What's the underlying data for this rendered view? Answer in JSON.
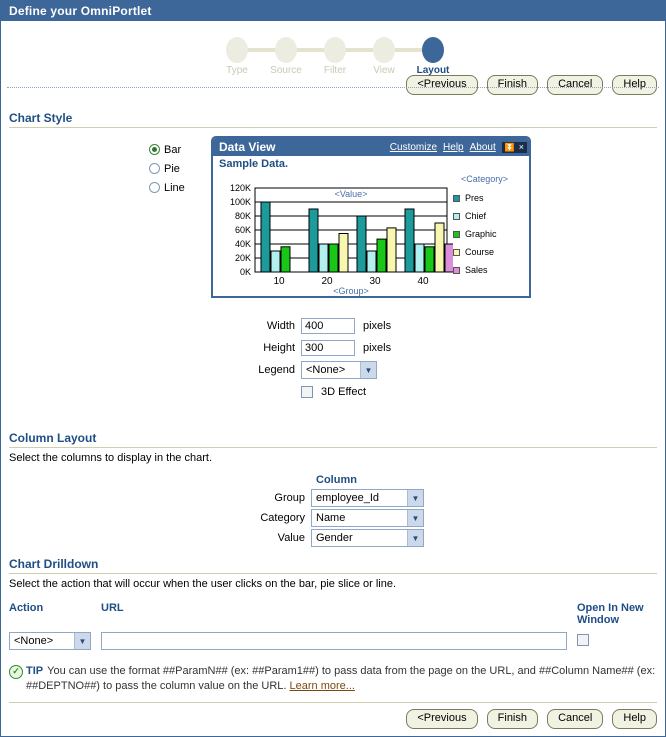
{
  "window": {
    "title": "Define your OmniPortlet"
  },
  "wizard": {
    "steps": [
      {
        "label": "Type",
        "current": false
      },
      {
        "label": "Source",
        "current": false
      },
      {
        "label": "Filter",
        "current": false
      },
      {
        "label": "View",
        "current": false
      },
      {
        "label": "Layout",
        "current": true
      }
    ]
  },
  "buttons": {
    "previous": "<Previous",
    "finish": "Finish",
    "cancel": "Cancel",
    "help": "Help"
  },
  "chart_style": {
    "title": "Chart Style",
    "types": [
      {
        "label": "Bar",
        "selected": true
      },
      {
        "label": "Pie",
        "selected": false
      },
      {
        "label": "Line",
        "selected": false
      }
    ],
    "width_label": "Width",
    "width_value": "400",
    "width_units": "pixels",
    "height_label": "Height",
    "height_value": "300",
    "height_units": "pixels",
    "legend_label": "Legend",
    "legend_value": "<None>",
    "effect3d_label": "3D Effect",
    "effect3d_checked": false
  },
  "portlet": {
    "title": "Data View",
    "links": [
      "Customize",
      "Help",
      "About"
    ],
    "icon_collapse": "⏫",
    "icon_close": "×",
    "sample_label": "Sample Data."
  },
  "chart_data": {
    "type": "bar",
    "title": "Sample Data.",
    "xlabel": "<Group>",
    "ylabel": "<Value>",
    "legend_title": "<Category>",
    "legend_position": "right",
    "grid": true,
    "ylim": [
      0,
      120000
    ],
    "ytick_labels": [
      "120K",
      "100K",
      "80K",
      "60K",
      "40K",
      "20K",
      "0K"
    ],
    "ytick_values": [
      120000,
      100000,
      80000,
      60000,
      40000,
      20000,
      0
    ],
    "categories": [
      "10",
      "20",
      "30",
      "40"
    ],
    "series": [
      {
        "name": "Pres",
        "color": "#1d9a9a",
        "values": [
          100000,
          90000,
          80000,
          90000
        ]
      },
      {
        "name": "Chief",
        "color": "#b2f0f0",
        "values": [
          30000,
          40000,
          30000,
          40000
        ]
      },
      {
        "name": "Graphic",
        "color": "#18c818",
        "values": [
          36000,
          40000,
          47000,
          36000
        ]
      },
      {
        "name": "Course",
        "color": "#f7f7b0",
        "values": [
          0,
          55000,
          63000,
          70000
        ]
      },
      {
        "name": "Sales",
        "color": "#d98fd9",
        "values": [
          0,
          0,
          0,
          40000
        ]
      }
    ]
  },
  "column_layout": {
    "title": "Column Layout",
    "description": "Select the columns to display in the chart.",
    "column_header": "Column",
    "rows": [
      {
        "label": "Group",
        "value": "employee_Id"
      },
      {
        "label": "Category",
        "value": "Name"
      },
      {
        "label": "Value",
        "value": "Gender"
      }
    ]
  },
  "drilldown": {
    "title": "Chart Drilldown",
    "description": "Select the action that will occur when the user clicks on the bar, pie slice or line.",
    "action_header": "Action",
    "url_header": "URL",
    "new_window_header": "Open In New Window",
    "action_value": "<None>",
    "url_value": "",
    "new_window_checked": false
  },
  "tip": {
    "label": "TIP",
    "text": "You can use the format ##ParamN## (ex: ##Param1##) to pass data from the page on the URL, and ##Column Name## (ex: ##DEPTNO##) to pass the column value on the URL.",
    "link": "Learn more..."
  }
}
